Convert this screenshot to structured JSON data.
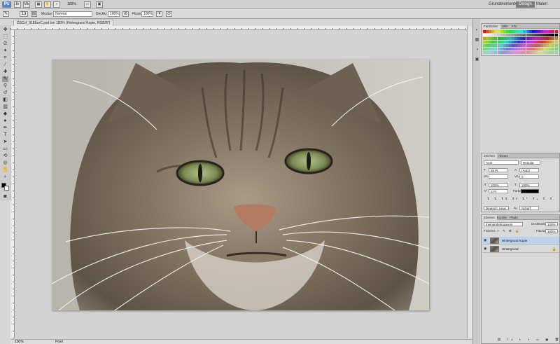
{
  "appbar": {
    "zoom": "100%",
    "workspaces": [
      "Grundelemente",
      "Design",
      "Malen"
    ],
    "active_workspace": "Design"
  },
  "options": {
    "mode_label": "Modus:",
    "mode_value": "Normal",
    "opacity_label": "Deckkr.:",
    "opacity_value": "100%",
    "flow_label": "Fluss:",
    "flow_value": "100%",
    "brush_size": "13"
  },
  "document": {
    "tab_title": "DSCxf_9186xxC.psd bei 100% (Hintergrund Kopie, RGB/8*)"
  },
  "status": {
    "zoom": "100%",
    "info": "Pixel"
  },
  "swatches": {
    "tabs": [
      "Farbfelder",
      "Stile",
      "Info"
    ]
  },
  "character": {
    "tabs": [
      "Zeichen",
      "Absatz"
    ],
    "font": "Arial",
    "style": "Regular",
    "size": "36 Pt",
    "leading": "(Auto)",
    "kerning": "",
    "tracking": "0",
    "vscale": "100%",
    "hscale": "100%",
    "baseline": "0 Pt",
    "color_label": "Farbe:",
    "color": "#000000",
    "language": "Deutsch: neue...",
    "aa": "Scharf"
  },
  "layers": {
    "tabs": [
      "Ebenen",
      "Kanäle",
      "Pfade"
    ],
    "blend": "Ineinanderkopieren",
    "opacity_label": "Deckkraft:",
    "opacity": "100%",
    "lock_label": "Fixieren:",
    "fill_label": "Fläche:",
    "fill": "100%",
    "items": [
      {
        "name": "Hintergrund Kopie",
        "selected": true
      },
      {
        "name": "Hintergrund",
        "selected": false
      }
    ]
  },
  "colors": {
    "accent": "#5b87c8",
    "selection": "#b9d3ef",
    "canvas": "#d3d3d3"
  }
}
